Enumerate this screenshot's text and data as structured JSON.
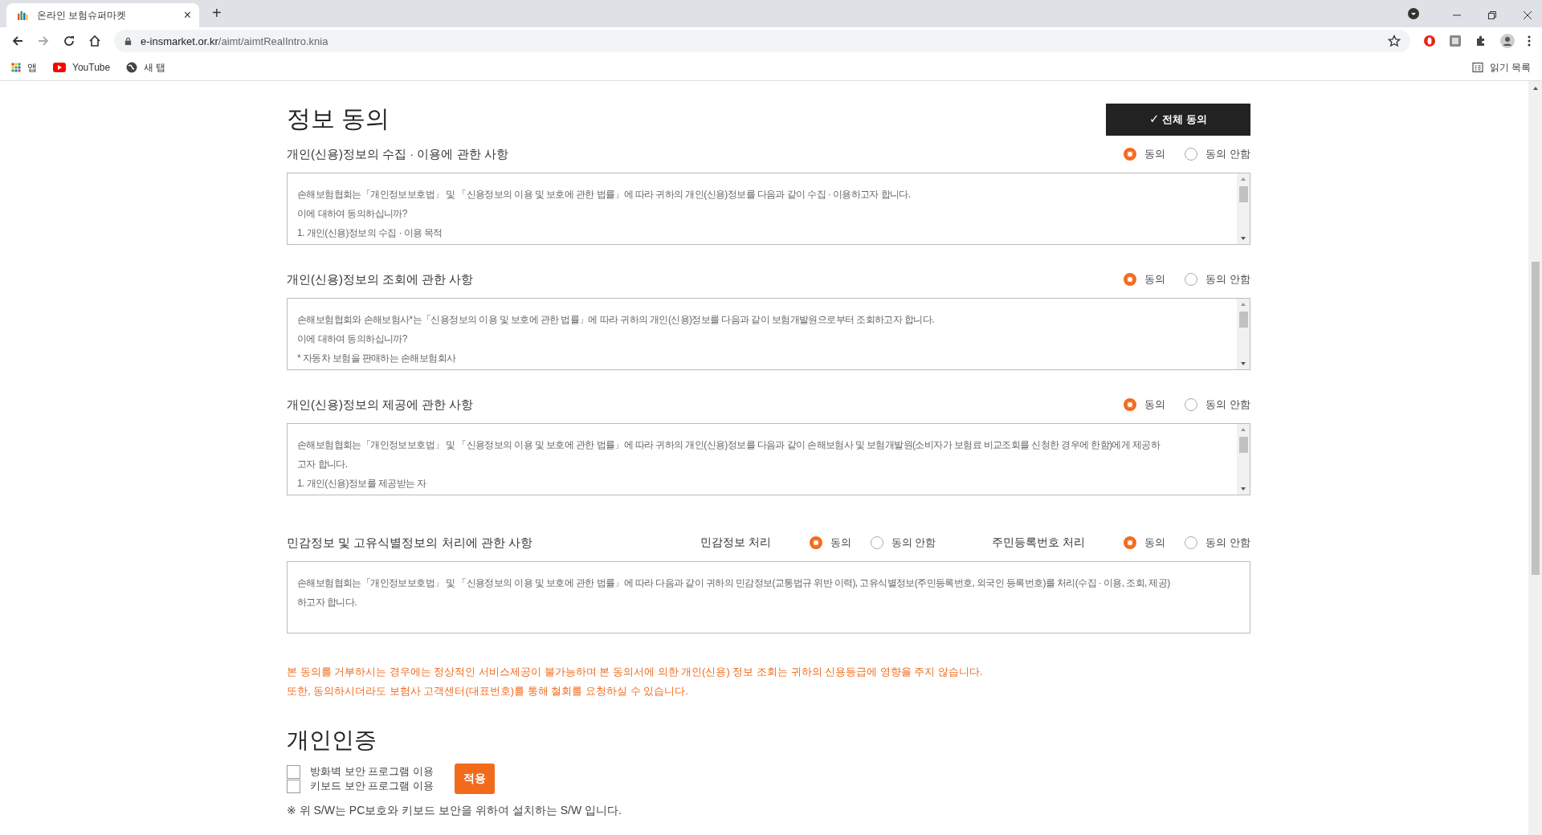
{
  "browser": {
    "tab": {
      "title": "온라인 보험슈퍼마켓",
      "close": "×"
    },
    "new_tab": "+",
    "url": {
      "host": "e-insmarket.or.kr",
      "path": "/aimt/aimtRealIntro.knia"
    },
    "bookmarks": [
      "앱",
      "YouTube",
      "새 탭"
    ],
    "reading_list": "읽기 목록"
  },
  "consent": {
    "title": "정보 동의",
    "all_agree_button": {
      "check": "✓",
      "label": "전체 동의"
    },
    "sections": [
      {
        "heading": "개인(신용)정보의 수집 · 이용에 관한 사항",
        "scrollable": true,
        "groups": [
          {
            "options": [
              {
                "label": "동의",
                "selected": true
              },
              {
                "label": "동의 안함",
                "selected": false
              }
            ]
          }
        ],
        "lines": [
          "손해보험협회는「개인정보보호법」 및 「신용정보의 이용 및 보호에 관한 법률」에 따라 귀하의 개인(신용)정보를 다음과 같이 수집 · 이용하고자 합니다.",
          "이에 대하여 동의하십니까?",
          "1. 개인(신용)정보의 수집 · 이용 목적"
        ]
      },
      {
        "heading": "개인(신용)정보의 조회에 관한 사항",
        "scrollable": true,
        "groups": [
          {
            "options": [
              {
                "label": "동의",
                "selected": true
              },
              {
                "label": "동의 안함",
                "selected": false
              }
            ]
          }
        ],
        "lines": [
          "손해보험협회와 손해보험사*는「신용정보의 이용 및 보호에 관한 법률」에 따라 귀하의 개인(신용)정보를 다음과 같이 보험개발원으로부터 조회하고자 합니다.",
          "이에 대하여 동의하십니까?",
          "* 자동차 보험을 판매하는 손해보험회사"
        ]
      },
      {
        "heading": "개인(신용)정보의 제공에 관한 사항",
        "scrollable": true,
        "groups": [
          {
            "options": [
              {
                "label": "동의",
                "selected": true
              },
              {
                "label": "동의 안함",
                "selected": false
              }
            ]
          }
        ],
        "lines": [
          "손해보험협회는「개인정보보호법」 및 「신용정보의 이용 및 보호에 관한 법률」에 따라 귀하의 개인(신용)정보를 다음과 같이 손해보험사 및 보험개발원(소비자가 보험료 비교조회를 신청한 경우에 한함)에게 제공하",
          "고자 합니다.",
          "1. 개인(신용)정보를 제공받는 자"
        ]
      },
      {
        "heading": "민감정보 및 고유식별정보의 처리에 관한 사항",
        "scrollable": false,
        "groups": [
          {
            "label": "민감정보 처리",
            "options": [
              {
                "label": "동의",
                "selected": true
              },
              {
                "label": "동의 안함",
                "selected": false
              }
            ]
          },
          {
            "label": "주민등록번호 처리",
            "options": [
              {
                "label": "동의",
                "selected": true
              },
              {
                "label": "동의 안함",
                "selected": false
              }
            ]
          }
        ],
        "lines": [
          "손해보험협회는「개인정보보호법」 및 「신용정보의 이용 및 보호에 관한 법률」에 따라 다음과 같이 귀하의 민감정보(교통법규 위반 이력), 고유식별정보(주민등록번호, 외국인 등록번호)를 처리(수집 · 이용, 조회, 제공)",
          "하고자 합니다."
        ]
      }
    ],
    "notice": [
      "본 동의를 거부하시는 경우에는 정상적인 서비스제공이 불가능하며 본 동의서에 의한 개인(신용) 정보 조회는 귀하의 신용등급에 영향을 주지 않습니다.",
      "또한, 동의하시더라도 보험사 고객센터(대표번호)를 통해 철회를 요청하실 수 있습니다."
    ]
  },
  "auth": {
    "title": "개인인증",
    "options": [
      {
        "label": "방화벽 보안 프로그램 이용",
        "checked": false
      },
      {
        "label": "키보드 보안 프로그램 이용",
        "checked": false
      }
    ],
    "apply_button": "적용",
    "note": "※ 위 S/W는 PC보호와 키보드 보안을 위하여 설치하는 S/W 입니다."
  }
}
